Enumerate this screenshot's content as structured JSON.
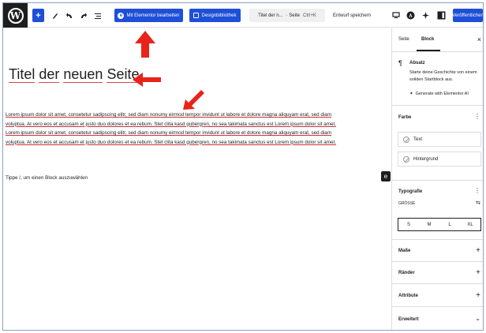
{
  "toolbar": {
    "wp_logo": "W",
    "add_icon": "+",
    "elementor_label": "Mit Elementor bearbeiten",
    "design_label": "Designbibliothek",
    "doc_title": "Titel der n...",
    "doc_type": "· Seite",
    "doc_shortcut": "Ctrl+K",
    "draft_label": "Entwurf speichern",
    "publish_label": "Veröffentlichen"
  },
  "content": {
    "title_words": [
      "Titel",
      "der",
      "neuen",
      "Seite"
    ],
    "paragraph_line1": "Lorem ipsum dolor sit amet, consetetur sadipscing elitr, sed diam nonumy eirmod tempor invidunt ut labore et dolore magna aliquyam erat, sed diam",
    "paragraph_line2": "voluptua. At vero eos et accusam et justo duo dolores et ea rebum. Stet clita kasd gubergren, no sea takimata sanctus est Lorem ipsum dolor sit amet.",
    "paragraph_line3": "Lorem ipsum dolor sit amet, consetetur sadipscing elitr, sed diam nonumy eirmod tempor invidunt ut labore et dolore magna aliquyam erat, sed diam",
    "paragraph_line4": "voluptua. At vero eos et accusam et justo duo dolores et ea rebum. Stet clita kasd gubergren, no sea takimata sanctus est Lorem ipsum dolor sit amet.",
    "placeholder": "Tippe /, um einen Block auszuwählen"
  },
  "sidebar": {
    "tab_page": "Seite",
    "tab_block": "Block",
    "close": "×",
    "block_name": "Absatz",
    "block_description": "Starte deine Geschichte von einem soliden Startblock aus.",
    "generate_label": "Generate with Elementor AI",
    "color_label": "Farbe",
    "color_text": "Text",
    "color_background": "Hintergrund",
    "typography_label": "Typografie",
    "size_label": "GRÖSSE",
    "sizes": [
      "S",
      "M",
      "L",
      "XL"
    ],
    "dimensions_label": "Maße",
    "borders_label": "Ränder",
    "attributes_label": "Attribute",
    "advanced_label": "Erweitert"
  },
  "colors": {
    "accent": "#1d4fd8",
    "arrow": "#e8231a"
  }
}
